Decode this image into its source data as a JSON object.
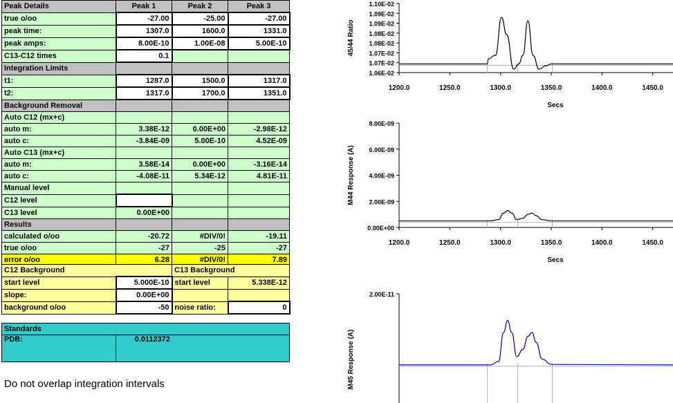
{
  "headers": {
    "title": "Peak Details",
    "peaks": [
      "Peak 1",
      "Peak 2",
      "Peak 3"
    ]
  },
  "peak_rows": [
    {
      "label": "true o/oo",
      "v": [
        "-27.00",
        "-25.00",
        "-27.00"
      ]
    },
    {
      "label": "peak time:",
      "v": [
        "1307.0",
        "1600.0",
        "1331.0"
      ]
    },
    {
      "label": "peak amps:",
      "v": [
        "8.00E-10",
        "1.00E-08",
        "5.00E-10"
      ]
    }
  ],
  "c13c12": {
    "label": "C13-C12 times",
    "value": "0.1"
  },
  "integration": {
    "title": "Integration Limits",
    "t1": {
      "label": "t1:",
      "v": [
        "1287.0",
        "1500.0",
        "1317.0"
      ]
    },
    "t2": {
      "label": "t2:",
      "v": [
        "1317.0",
        "1700.0",
        "1351.0"
      ]
    }
  },
  "background": {
    "title": "Background Removal",
    "auto12": {
      "label": "Auto  C12 (mx+c)",
      "m_label": "auto m:",
      "c_label": "auto c:",
      "m": [
        "3.38E-12",
        "0.00E+00",
        "-2.98E-12"
      ],
      "c": [
        "-3.84E-09",
        "5.00E-10",
        "4.52E-09"
      ]
    },
    "auto13": {
      "label": "Auto C13 (mx+c)",
      "m_label": "auto m:",
      "c_label": "auto c:",
      "m": [
        "3.58E-14",
        "0.00E+00",
        "-3.16E-14"
      ],
      "c": [
        "-4.08E-11",
        "5.34E-12",
        "4.81E-11"
      ]
    },
    "manual": {
      "label": "Manual level",
      "c12": "C12 level",
      "c12_value": "",
      "c13": "C13 level",
      "c13_value": "0.00E+00"
    }
  },
  "results": {
    "title": "Results",
    "calc": {
      "label": "calculated o/oo",
      "v": [
        "-20.72",
        "#DIV/0!",
        "-19.11"
      ]
    },
    "true": {
      "label": "true o/oo",
      "v": [
        "-27",
        "-25",
        "-27"
      ]
    },
    "error": {
      "label": "error o/oo",
      "v": [
        "6.28",
        "#DIV/0!",
        "7.89"
      ]
    }
  },
  "c12bg": {
    "title": "C12 Background",
    "start_label": "start level",
    "start": "5.000E-10",
    "slope_label": "slope:",
    "slope": "0.00E+00",
    "bg_label": "background o/oo",
    "bg": "-50"
  },
  "c13bg": {
    "title": "C13 Background",
    "start_label": "start level",
    "start": "5.338E-12",
    "noise_label": "noise ratio:",
    "noise": "0"
  },
  "standards": {
    "title": "Standards",
    "pdb_label": "PDB:",
    "pdb": "0.0112372"
  },
  "note": "Do not overlap integration intervals",
  "chart_data": [
    {
      "type": "line",
      "ylabel": "45/44 Ratio",
      "xlabel": "Secs",
      "yticks": [
        "1.06E-02",
        "1.07E-02",
        "1.07E-02",
        "1.08E-02",
        "1.08E-02",
        "1.09E-02",
        "1.09E-02",
        "1.10E-02"
      ],
      "xticks": [
        "1200.0",
        "1250.0",
        "1300.0",
        "1350.0",
        "1400.0",
        "1450.0"
      ],
      "xlim": [
        1200,
        1470
      ],
      "ylim": [
        0.0106,
        0.011
      ],
      "series": [
        {
          "x": [
            1200,
            1287,
            1288,
            1295,
            1301,
            1306,
            1313,
            1318,
            1322,
            1327,
            1332,
            1338,
            1345,
            1350,
            1470
          ],
          "y": [
            0.01065,
            0.01065,
            0.01068,
            0.0107,
            0.01092,
            0.01082,
            0.01062,
            0.01065,
            0.0107,
            0.0109,
            0.0107,
            0.01062,
            0.01064,
            0.01065,
            0.01065
          ]
        }
      ],
      "color": "#000000"
    },
    {
      "type": "line",
      "ylabel": "M44 Response (A)",
      "xlabel": "Secs",
      "yticks": [
        "0.00E+00",
        "2.00E-09",
        "4.00E-09",
        "6.00E-09",
        "8.00E-09"
      ],
      "xticks": [
        "1200.0",
        "1250.0",
        "1300.0",
        "1350.0",
        "1400.0",
        "1450.0"
      ],
      "xlim": [
        1200,
        1470
      ],
      "ylim": [
        0,
        8e-09
      ],
      "series": [
        {
          "x": [
            1200,
            1290,
            1298,
            1303,
            1307,
            1311,
            1316,
            1322,
            1327,
            1331,
            1335,
            1341,
            1350,
            1470
          ],
          "y": [
            5e-10,
            5e-10,
            6e-10,
            1.1e-09,
            1.3e-09,
            1.1e-09,
            6e-10,
            7e-10,
            1e-09,
            1.1e-09,
            9e-10,
            6e-10,
            5e-10,
            5e-10
          ]
        }
      ],
      "color": "#000000"
    },
    {
      "type": "line",
      "ylabel": "M45 Response (A)",
      "yticks": [
        "2.00E-11"
      ],
      "xticks": [],
      "xlim": [
        1200,
        1470
      ],
      "ylim": [
        0,
        2e-11
      ],
      "series": [
        {
          "x": [
            1200,
            1290,
            1298,
            1303,
            1307,
            1311,
            1316,
            1322,
            1327,
            1331,
            1335,
            1341,
            1350,
            1470
          ],
          "y": [
            5.3e-12,
            5.3e-12,
            6e-12,
            1.2e-11,
            1.45e-11,
            1.2e-11,
            7e-12,
            8.5e-12,
            1.12e-11,
            1.2e-11,
            1e-11,
            6.5e-12,
            5.4e-12,
            5.3e-12
          ]
        }
      ],
      "color": "#0000cc"
    }
  ]
}
